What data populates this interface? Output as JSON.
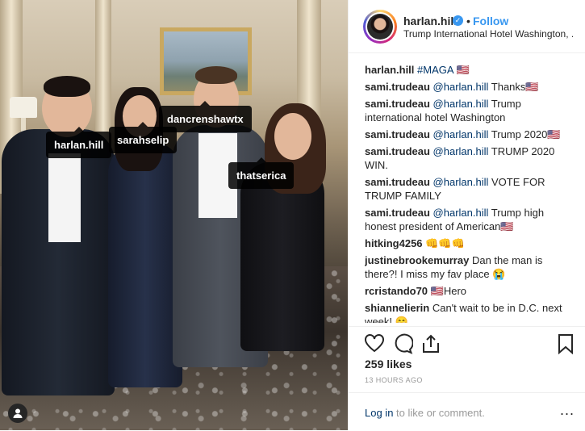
{
  "post": {
    "username": "harlan.hill",
    "follow_label": "Follow",
    "separator": "•",
    "location": "Trump International Hotel Washington, ...",
    "photo_tags": [
      "harlan.hill",
      "sarahselip",
      "dancrenshawtx",
      "thatserica"
    ],
    "caption": {
      "user": "harlan.hill",
      "text": "#MAGA 🇺🇸"
    },
    "comments": [
      {
        "user": "sami.trudeau",
        "mention": "@harlan.hill",
        "text": "Thanks🇺🇸"
      },
      {
        "user": "sami.trudeau",
        "mention": "@harlan.hill",
        "text": "Trump international hotel Washington"
      },
      {
        "user": "sami.trudeau",
        "mention": "@harlan.hill",
        "text": "Trump 2020🇺🇸"
      },
      {
        "user": "sami.trudeau",
        "mention": "@harlan.hill",
        "text": "TRUMP 2020 WIN."
      },
      {
        "user": "sami.trudeau",
        "mention": "@harlan.hill",
        "text": "VOTE FOR TRUMP FAMILY"
      },
      {
        "user": "sami.trudeau",
        "mention": "@harlan.hill",
        "text": "Trump high honest president of American🇺🇸"
      },
      {
        "user": "hitking4256",
        "mention": "",
        "text": "👊👊👊"
      },
      {
        "user": "justinebrookemurray",
        "mention": "",
        "text": "Dan the man is there?! I miss my fav place 😭"
      },
      {
        "user": "rcristando70",
        "mention": "",
        "text": "🇺🇸Hero"
      },
      {
        "user": "shiannelierin",
        "mention": "",
        "text": "Can't wait to be in D.C. next week! 😄"
      }
    ],
    "likes": "259 likes",
    "timestamp": "13 HOURS AGO",
    "login_link": "Log in",
    "login_text": " to like or comment.",
    "more_label": "..."
  },
  "icons": [
    "heart-icon",
    "comment-icon",
    "share-icon",
    "bookmark-icon",
    "verified-icon",
    "user-tag-icon"
  ],
  "colors": {
    "link": "#003569",
    "follow": "#3897f0",
    "muted": "#999999",
    "text": "#262626"
  }
}
